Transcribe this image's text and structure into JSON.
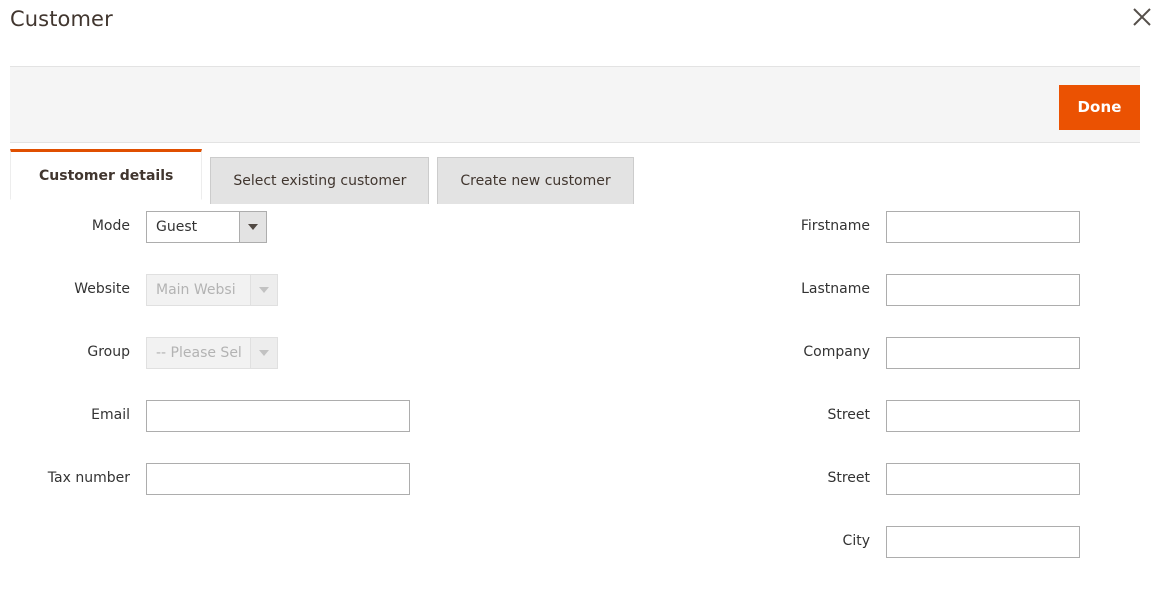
{
  "modal": {
    "title": "Customer",
    "close_icon": "close-icon"
  },
  "toolbar": {
    "done_label": "Done",
    "accent_color": "#eb5202"
  },
  "tabs": [
    {
      "label": "Customer details",
      "active": true
    },
    {
      "label": "Select existing customer",
      "active": false
    },
    {
      "label": "Create new customer",
      "active": false
    }
  ],
  "form": {
    "left_column": [
      {
        "label": "Mode",
        "type": "select",
        "value": "Guest",
        "disabled": false
      },
      {
        "label": "Website",
        "type": "select",
        "value": "Main Websi",
        "disabled": true
      },
      {
        "label": "Group",
        "type": "select",
        "value": "-- Please Sel",
        "disabled": true
      },
      {
        "label": "Email",
        "type": "text",
        "value": "",
        "placeholder": ""
      },
      {
        "label": "Tax number",
        "type": "text",
        "value": "",
        "placeholder": ""
      }
    ],
    "right_column": [
      {
        "label": "Firstname",
        "type": "text",
        "value": "",
        "placeholder": ""
      },
      {
        "label": "Lastname",
        "type": "text",
        "value": "",
        "placeholder": ""
      },
      {
        "label": "Company",
        "type": "text",
        "value": "",
        "placeholder": ""
      },
      {
        "label": "Street",
        "type": "text",
        "value": "",
        "placeholder": ""
      },
      {
        "label": "Street",
        "type": "text",
        "value": "",
        "placeholder": ""
      },
      {
        "label": "City",
        "type": "text",
        "value": "",
        "placeholder": ""
      }
    ]
  }
}
